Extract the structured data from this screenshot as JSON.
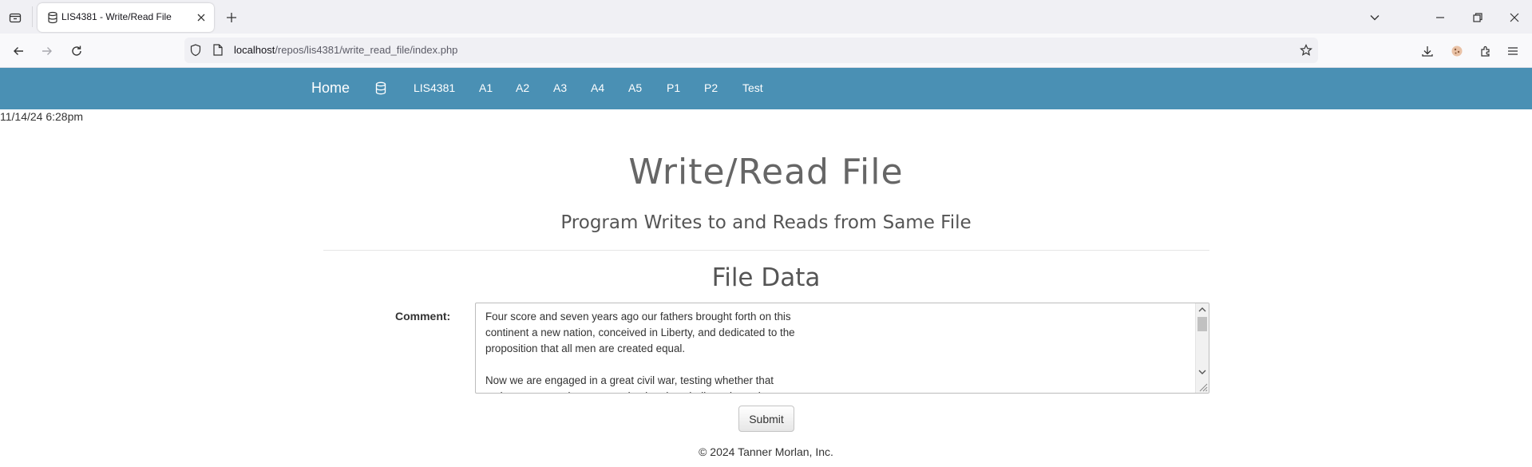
{
  "browser": {
    "tab_title": "LIS4381 - Write/Read File",
    "url_host": "localhost",
    "url_path": "/repos/lis4381/write_read_file/index.php",
    "icons": [
      "tab-list-icon",
      "close-icon",
      "plus-icon",
      "chevron-down-icon",
      "minimize-icon",
      "restore-icon",
      "back-icon",
      "forward-icon",
      "reload-icon",
      "shield-icon",
      "page-icon",
      "star-icon",
      "download-icon",
      "extension-icon",
      "menu-icon"
    ]
  },
  "nav": {
    "brand": "Home",
    "links": [
      "LIS4381",
      "A1",
      "A2",
      "A3",
      "A4",
      "A5",
      "P1",
      "P2",
      "Test"
    ],
    "background": "#4a90b4"
  },
  "timestamp": "11/14/24 6:28pm",
  "page": {
    "title": "Write/Read File",
    "subtitle": "Program Writes to and Reads from Same File",
    "section_title": "File Data",
    "comment_label": "Comment:",
    "comment_text": "Four score and seven years ago our fathers brought forth on this\ncontinent a new nation, conceived in Liberty, and dedicated to the\nproposition that all men are created equal.\n\nNow we are engaged in a great civil war, testing whether that\nnation, or any nation so conceived and so dedicated, can long",
    "submit_label": "Submit",
    "footer": "© 2024 Tanner Morlan, Inc."
  }
}
